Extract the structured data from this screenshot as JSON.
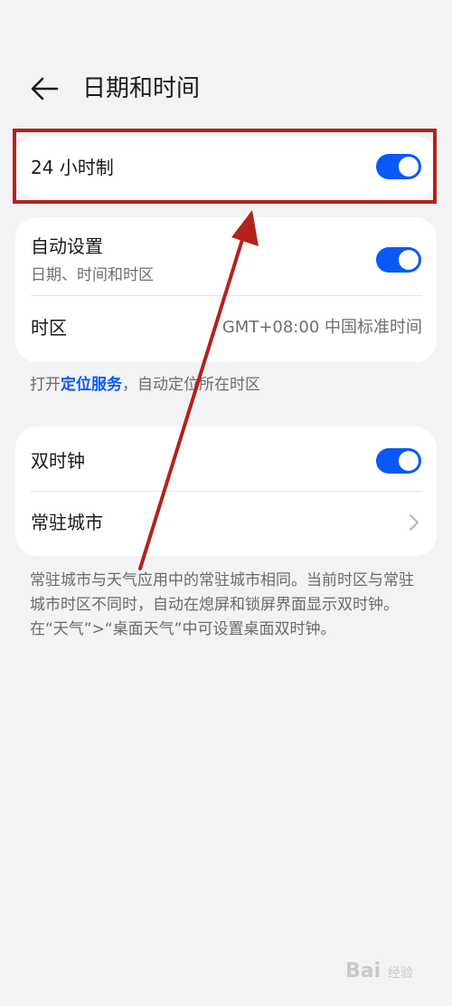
{
  "header": {
    "title": "日期和时间"
  },
  "card_24h": {
    "label": "24 小时制",
    "toggle_on": true
  },
  "card_auto": {
    "auto_label": "自动设置",
    "auto_sub": "日期、时间和时区",
    "auto_toggle_on": true,
    "timezone_label": "时区",
    "timezone_value": "GMT+08:00 中国标准时间"
  },
  "location_hint": {
    "prefix": "打开",
    "link": "定位服务",
    "suffix": "，自动定位所在时区"
  },
  "card_dual": {
    "dual_label": "双时钟",
    "dual_toggle_on": true,
    "city_label": "常驻城市"
  },
  "note": "常驻城市与天气应用中的常驻城市相同。当前时区与常驻城市时区不同时，自动在熄屏和锁屏界面显示双时钟。在“天气”>“桌面天气”中可设置桌面双时钟。",
  "watermark": {
    "text": "Bai",
    "sub": "经验"
  },
  "colors": {
    "accent": "#0a59f7",
    "annotation": "#b3221c",
    "background": "#f1f3f5"
  },
  "icons": {
    "back": "arrow-left-icon",
    "chevron": "chevron-right-icon"
  }
}
